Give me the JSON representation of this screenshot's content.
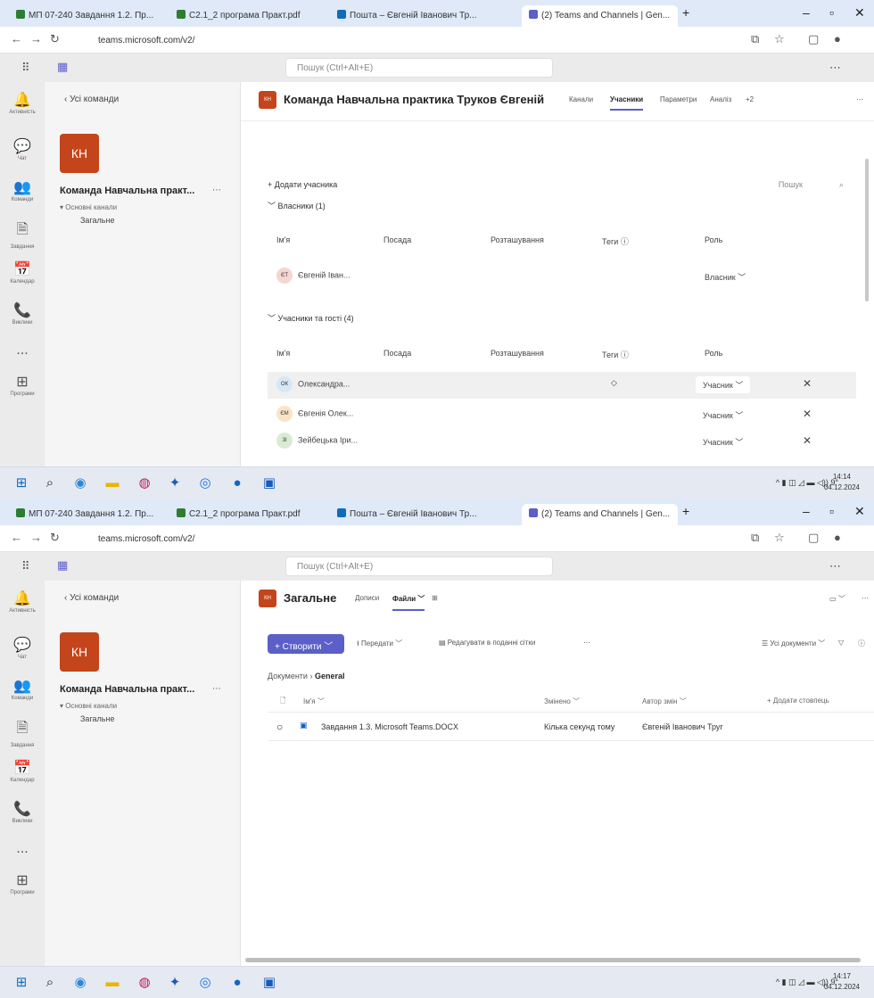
{
  "shot1": {
    "browser": {
      "tabs": [
        "МП 07-240 Завдання 1.2. Пр...",
        "С2.1_2 програма Практ.pdf",
        "Пошта – Євгеній Іванович Тр...",
        "(2) Teams and Channels | Gen..."
      ],
      "url": "teams.microsoft.com/v2/"
    },
    "search_placeholder": "Пошук (Ctrl+Alt+E)",
    "rail": [
      "Активність",
      "Чат",
      "Команди",
      "Завдання",
      "Календар",
      "Виклики",
      "...",
      "Програми"
    ],
    "sidebar": {
      "back": "Усі команди",
      "avatar": "КН",
      "team_name": "Команда Навчальна практ...",
      "section": "Основні канали",
      "channel": "Загальне"
    },
    "header": {
      "avatar": "КН",
      "title": "Команда Навчальна практика Труков Євгеній",
      "tabs": [
        "Канали",
        "Учасники",
        "Параметри",
        "Аналіз",
        "+2"
      ]
    },
    "members": {
      "add_label": "Додати учасника",
      "search": "Пошук",
      "owners_section": "Власники (1)",
      "columns": [
        "Ім'я",
        "Посада",
        "Розташування",
        "Теги",
        "Роль"
      ],
      "owners": [
        {
          "initials": "ЄТ",
          "name": "Євгеній Іван...",
          "role": "Власник"
        }
      ],
      "guests_section": "Учасники та гості (4)",
      "guests": [
        {
          "initials": "ОК",
          "name": "Олександра...",
          "role": "Учасник"
        },
        {
          "initials": "ЄМ",
          "name": "Євгенія Олек...",
          "role": "Учасник"
        },
        {
          "initials": "ЗІ",
          "name": "Зейбецька Іри...",
          "role": "Учасник"
        }
      ]
    },
    "clock": {
      "time": "14:14",
      "date": "04.12.2024"
    }
  },
  "shot2": {
    "browser": {
      "tabs": [
        "МП 07-240 Завдання 1.2. Пр...",
        "С2.1_2 програма Практ.pdf",
        "Пошта – Євгеній Іванович Тр...",
        "(2) Teams and Channels | Gen..."
      ],
      "url": "teams.microsoft.com/v2/"
    },
    "search_placeholder": "Пошук (Ctrl+Alt+E)",
    "rail": [
      "Активність",
      "Чат",
      "Команди",
      "Завдання",
      "Календар",
      "Виклики",
      "...",
      "Програми"
    ],
    "sidebar": {
      "back": "Усі команди",
      "avatar": "КН",
      "team_name": "Команда Навчальна практ...",
      "section": "Основні канали",
      "channel": "Загальне"
    },
    "header": {
      "avatar": "КН",
      "title": "Загальне",
      "tabs": [
        "Допиcи",
        "Файли"
      ]
    },
    "files": {
      "new_button": "+ Створити",
      "upload": "Передати",
      "edit_grid": "Редагувати в поданні сітки",
      "all_docs": "Усі документи",
      "breadcrumb_root": "Документи",
      "breadcrumb_current": "General",
      "columns": [
        "Ім'я",
        "Змінено",
        "Автор змін",
        "+ Додати стовпець"
      ],
      "rows": [
        {
          "name": "Завдання 1.3. Microsoft Teams.DOCX",
          "modified": "Кілька секунд тому",
          "author": "Євгеній Іванович Труг"
        }
      ]
    },
    "clock": {
      "time": "14:17",
      "date": "04.12.2024"
    }
  }
}
